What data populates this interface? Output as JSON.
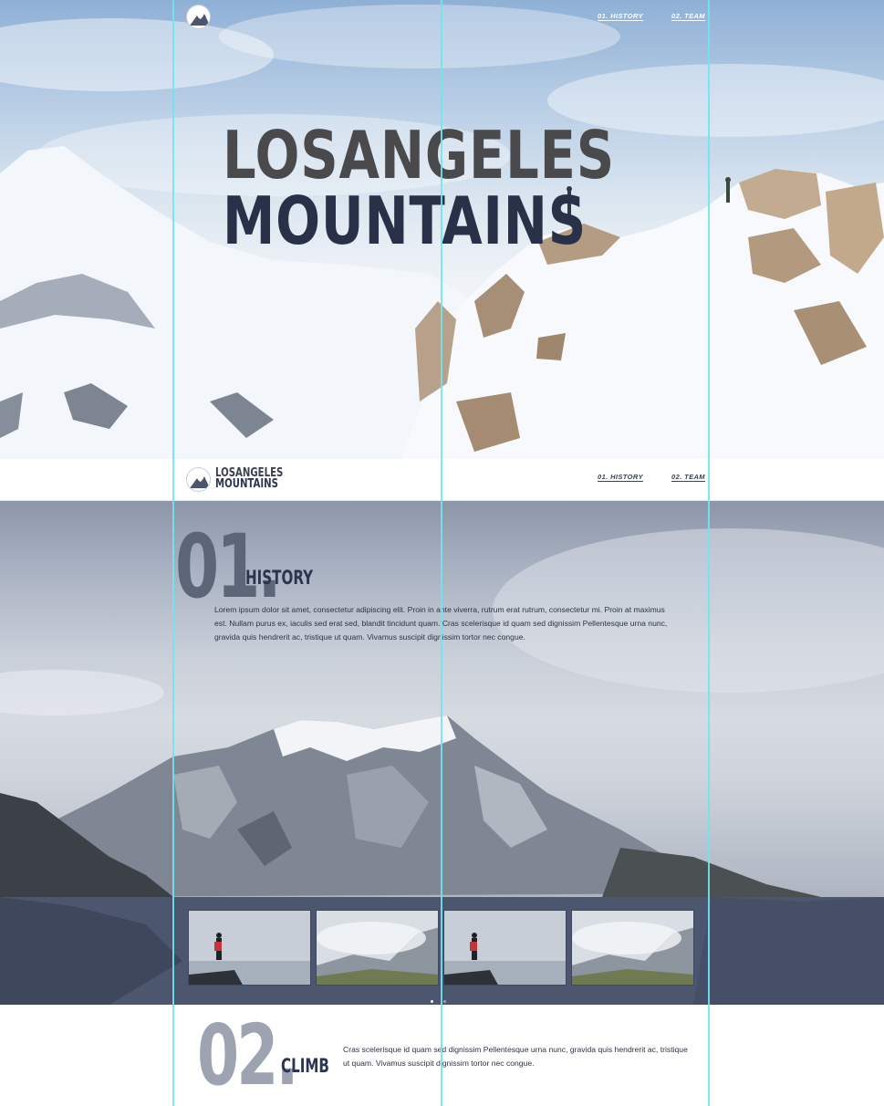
{
  "hero": {
    "title_line1": "LOSANGELES",
    "title_line2": "MOUNTAINS",
    "nav": [
      {
        "label": "01. HISTORY"
      },
      {
        "label": "02. TEAM"
      }
    ]
  },
  "header": {
    "brand_line1": "LOSANGELES",
    "brand_line2": "MOUNTAINS",
    "nav": [
      {
        "label": "01. HISTORY"
      },
      {
        "label": "02. TEAM"
      }
    ]
  },
  "history": {
    "number": "01.",
    "title": "HISTORY",
    "text": "Lorem ipsum dolor sit amet, consectetur adipiscing elit. Proin in ante viverra, rutrum erat rutrum, consectetur mi. Proin at maximus est. Nullam purus ex, iaculis sed erat sed, blandit tincidunt quam. Cras scelerisque id quam sed dignissim Pellentesque urna nunc, gravida quis hendrerit ac, tristique ut quam. Vivamus suscipit dignissim tortor nec congue."
  },
  "gallery": {
    "slides": [
      {
        "icon": "hiker-on-cliff-photo"
      },
      {
        "icon": "misty-valley-photo"
      },
      {
        "icon": "hiker-on-cliff-photo"
      },
      {
        "icon": "misty-valley-photo"
      }
    ],
    "pager": {
      "total": 2,
      "active": 0
    }
  },
  "climb": {
    "number": "02.",
    "title": "CLIMB",
    "text": "Cras scelerisque id quam sed dignissim Pellentesque urna nunc, gravida quis hendrerit ac, tristique ut quam. Vivamus suscipit dignissim tortor nec congue."
  },
  "colors": {
    "accent_dark": "#2b3550",
    "guide_line": "#6fe6ee",
    "gallery_bg": "#4c566e"
  },
  "icons": {
    "logo": "mountain-logo-icon"
  }
}
